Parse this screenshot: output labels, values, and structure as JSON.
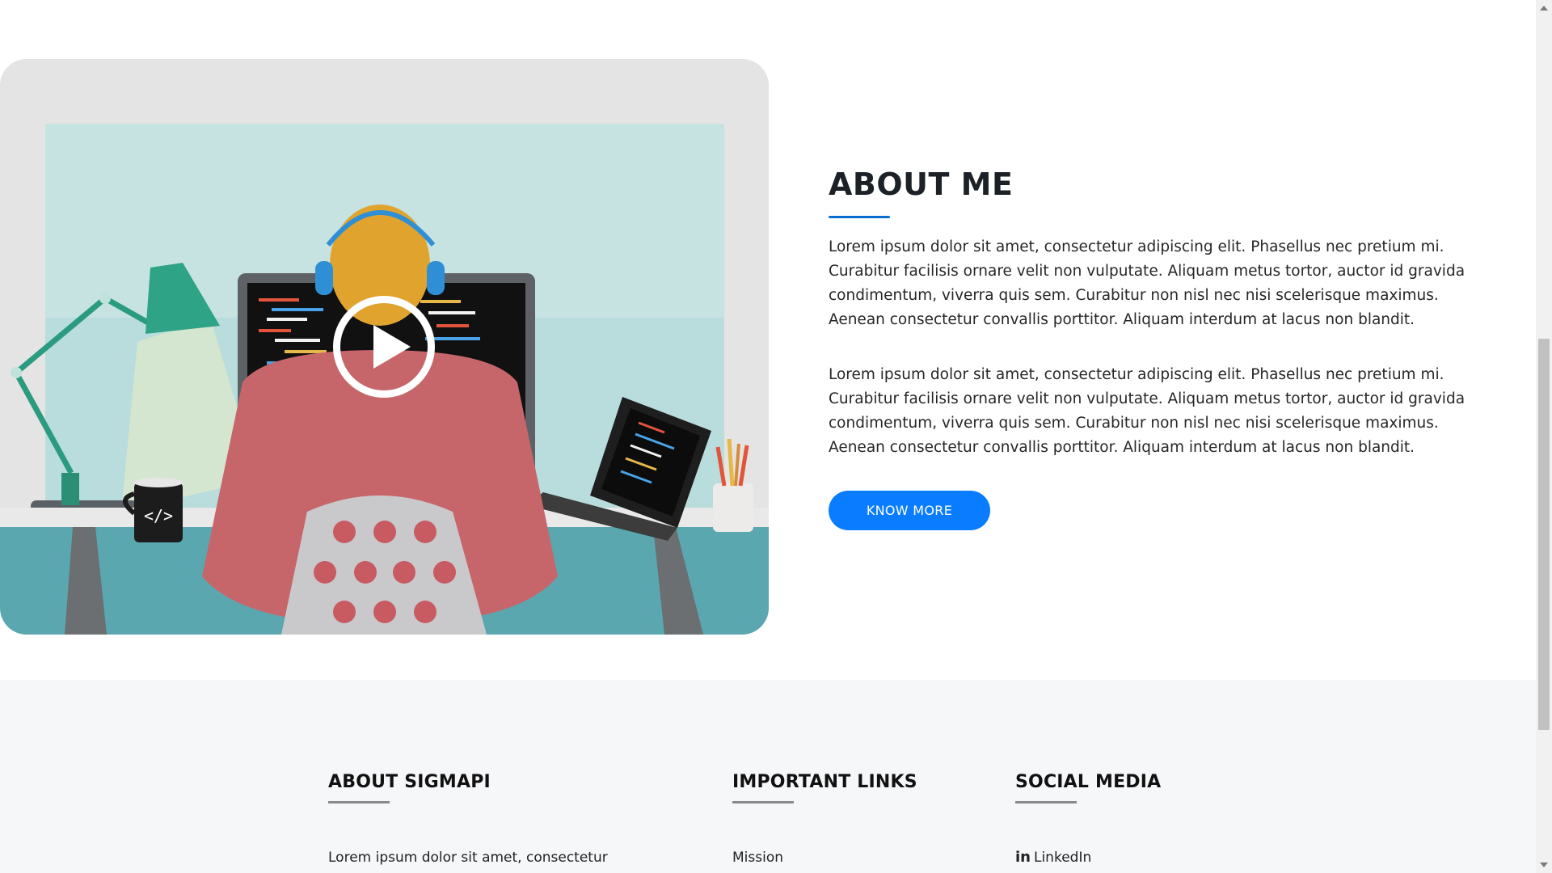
{
  "about": {
    "title": "ABOUT ME",
    "paragraphs": [
      "Lorem ipsum dolor sit amet, consectetur adipiscing elit. Phasellus nec pretium mi. Curabitur facilisis ornare velit non vulputate. Aliquam metus tortor, auctor id gravida condimentum, viverra quis sem. Curabitur non nisl nec nisi scelerisque maximus. Aenean consectetur convallis porttitor. Aliquam interdum at lacus non blandit.",
      "Lorem ipsum dolor sit amet, consectetur adipiscing elit. Phasellus nec pretium mi. Curabitur facilisis ornare velit non vulputate. Aliquam metus tortor, auctor id gravida condimentum, viverra quis sem. Curabitur non nisl nec nisi scelerisque maximus. Aenean consectetur convallis porttitor. Aliquam interdum at lacus non blandit."
    ],
    "button_label": "KNOW MORE",
    "mug_label": "</>",
    "video_icon": "play-icon"
  },
  "footer": {
    "columns": [
      {
        "title": "ABOUT SIGMAPI",
        "first_item": "Lorem ipsum dolor sit amet, consectetur"
      },
      {
        "title": "IMPORTANT LINKS",
        "first_item": "Mission"
      },
      {
        "title": "SOCIAL MEDIA",
        "first_item": "LinkedIn",
        "icon_text": "in"
      }
    ]
  },
  "colors": {
    "accent": "#0a7cff",
    "title_underline": "#0a6fd1",
    "footer_bg": "#f6f7f9"
  }
}
